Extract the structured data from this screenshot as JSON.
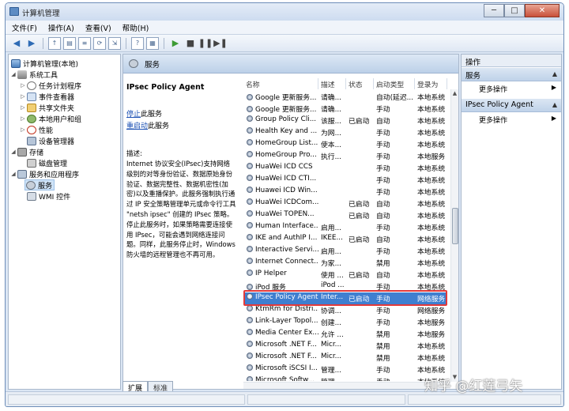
{
  "window": {
    "title": "计算机管理",
    "buttons": {
      "minimize": "─",
      "maximize": "□",
      "close": "✕"
    }
  },
  "menubar": [
    "文件(F)",
    "操作(A)",
    "查看(V)",
    "帮助(H)"
  ],
  "tree": {
    "items": [
      {
        "label": "计算机管理(本地)",
        "icon": "computer-icon"
      },
      {
        "label": "系统工具",
        "icon": "tools-icon"
      },
      {
        "label": "任务计划程序",
        "icon": "clock-icon"
      },
      {
        "label": "事件查看器",
        "icon": "event-viewer-icon"
      },
      {
        "label": "共享文件夹",
        "icon": "shared-folder-icon"
      },
      {
        "label": "本地用户和组",
        "icon": "users-icon"
      },
      {
        "label": "性能",
        "icon": "performance-icon"
      },
      {
        "label": "设备管理器",
        "icon": "device-manager-icon"
      },
      {
        "label": "存储",
        "icon": "storage-icon"
      },
      {
        "label": "磁盘管理",
        "icon": "disk-icon"
      },
      {
        "label": "服务和应用程序",
        "icon": "services-apps-icon"
      },
      {
        "label": "服务",
        "icon": "gear-icon"
      },
      {
        "label": "WMI 控件",
        "icon": "wmi-icon"
      }
    ]
  },
  "center": {
    "header": "服务",
    "selected_service": "IPsec Policy Agent",
    "stop_link_prefix": "停止",
    "stop_link_suffix": "此服务",
    "restart_link_prefix": "重启动",
    "restart_link_suffix": "此服务",
    "desc_label": "描述:",
    "description": "Internet 协议安全(IPsec)支持网络级别的对等身份验证、数据原始身份验证、数据完整性、数据机密性(加密)以及重播保护。此服务强制执行通过 IP 安全策略管理单元或命令行工具 \"netsh ipsec\" 创建的 IPsec 策略。停止此服务时，如果策略需要连接使用 IPsec，可能会遇到网络连接问题。同样，此服务停止时，Windows 防火墙的远程管理也不再可用。",
    "tabs": [
      "扩展",
      "标准"
    ]
  },
  "table": {
    "columns": [
      "名称",
      "描述",
      "状态",
      "启动类型",
      "登录为"
    ],
    "rows": [
      {
        "name": "Google 更新服务...",
        "desc": "请确...",
        "status": "",
        "startup": "自动(延迟...",
        "logon": "本地系统"
      },
      {
        "name": "Google 更新服务...",
        "desc": "请确...",
        "status": "",
        "startup": "手动",
        "logon": "本地系统"
      },
      {
        "name": "Group Policy Cli...",
        "desc": "该服...",
        "status": "已启动",
        "startup": "自动",
        "logon": "本地系统"
      },
      {
        "name": "Health Key and ...",
        "desc": "为网...",
        "status": "",
        "startup": "手动",
        "logon": "本地系统"
      },
      {
        "name": "HomeGroup List...",
        "desc": "使本...",
        "status": "",
        "startup": "手动",
        "logon": "本地系统"
      },
      {
        "name": "HomeGroup Pro...",
        "desc": "执行...",
        "status": "",
        "startup": "手动",
        "logon": "本地服务"
      },
      {
        "name": "HuaWei ICD CCS",
        "desc": "",
        "status": "",
        "startup": "手动",
        "logon": "本地系统"
      },
      {
        "name": "HuaWei ICD CTI...",
        "desc": "",
        "status": "",
        "startup": "手动",
        "logon": "本地系统"
      },
      {
        "name": "Huawei ICD Win...",
        "desc": "",
        "status": "",
        "startup": "手动",
        "logon": "本地系统"
      },
      {
        "name": "HuaWei ICDCom...",
        "desc": "",
        "status": "已启动",
        "startup": "自动",
        "logon": "本地系统"
      },
      {
        "name": "HuaWei TOPEN...",
        "desc": "",
        "status": "已启动",
        "startup": "自动",
        "logon": "本地系统"
      },
      {
        "name": "Human Interface...",
        "desc": "启用...",
        "status": "",
        "startup": "手动",
        "logon": "本地系统"
      },
      {
        "name": "IKE and AuthIP I...",
        "desc": "IKEE...",
        "status": "已启动",
        "startup": "自动",
        "logon": "本地系统"
      },
      {
        "name": "Interactive Servi...",
        "desc": "启用...",
        "status": "",
        "startup": "手动",
        "logon": "本地系统"
      },
      {
        "name": "Internet Connect...",
        "desc": "为家...",
        "status": "",
        "startup": "禁用",
        "logon": "本地系统"
      },
      {
        "name": "IP Helper",
        "desc": "使用 ...",
        "status": "已启动",
        "startup": "自动",
        "logon": "本地系统"
      },
      {
        "name": "iPod 服务",
        "desc": "iPod ...",
        "status": "",
        "startup": "手动",
        "logon": "本地系统"
      },
      {
        "name": "IPsec Policy Agent",
        "desc": "Inter...",
        "status": "已启动",
        "startup": "手动",
        "logon": "网络服务"
      },
      {
        "name": "KtmRm for Distri...",
        "desc": "协调...",
        "status": "",
        "startup": "手动",
        "logon": "网络服务"
      },
      {
        "name": "Link-Layer Topol...",
        "desc": "创建...",
        "status": "",
        "startup": "手动",
        "logon": "本地服务"
      },
      {
        "name": "Media Center Ex...",
        "desc": "允许 ...",
        "status": "",
        "startup": "禁用",
        "logon": "本地服务"
      },
      {
        "name": "Microsoft .NET F...",
        "desc": "Micr...",
        "status": "",
        "startup": "禁用",
        "logon": "本地系统"
      },
      {
        "name": "Microsoft .NET F...",
        "desc": "Micr...",
        "status": "",
        "startup": "禁用",
        "logon": "本地系统"
      },
      {
        "name": "Microsoft iSCSI I...",
        "desc": "管理...",
        "status": "",
        "startup": "手动",
        "logon": "本地系统"
      },
      {
        "name": "Microsoft Softw...",
        "desc": "管理...",
        "status": "",
        "startup": "手动",
        "logon": "本地系统"
      }
    ],
    "selected_index": 17
  },
  "actions": {
    "title": "操作",
    "section1": "服务",
    "more1": "更多操作",
    "section2": "IPsec Policy Agent",
    "more2": "更多操作"
  },
  "watermark": "知乎 @红莲弓矢",
  "colors": {
    "selection": "#3f7fd0",
    "highlight_box": "#e23a3a",
    "link": "#1a4fb3"
  }
}
